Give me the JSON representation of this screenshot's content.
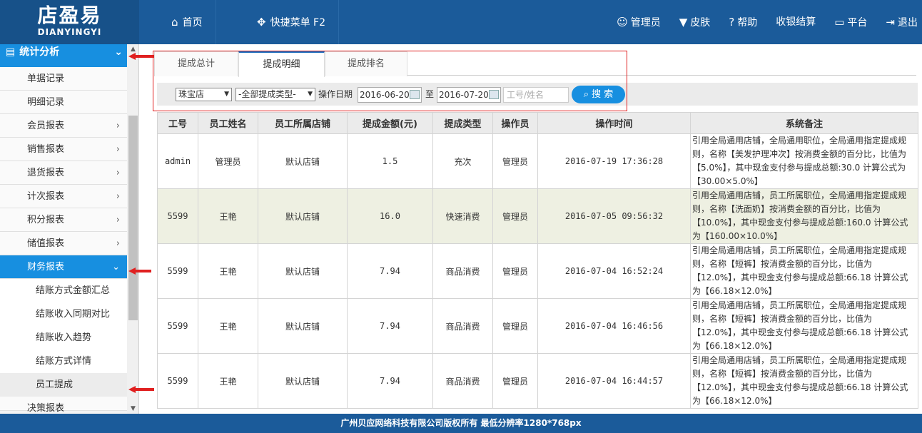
{
  "app": {
    "logo_cn": "店盈易",
    "logo_en": "DIANYINGYI"
  },
  "topnav": [
    {
      "icon": "home-icon",
      "glyph": "⌂",
      "label": "首页"
    },
    {
      "icon": "move-icon",
      "glyph": "✥",
      "label": "快捷菜单 F2"
    }
  ],
  "topright": [
    {
      "icon": "user-icon",
      "glyph": "👤",
      "label": "管理员"
    },
    {
      "icon": "shirt-icon",
      "glyph": "👕",
      "label": "皮肤"
    },
    {
      "icon": "help-icon",
      "glyph": "?",
      "label": "帮助"
    },
    {
      "icon": "",
      "glyph": "",
      "label": "收银结算"
    },
    {
      "icon": "monitor-icon",
      "glyph": "▭",
      "label": "平台"
    },
    {
      "icon": "logout-icon",
      "glyph": "⇥",
      "label": "退出"
    }
  ],
  "sidebar": {
    "header": "统计分析",
    "items": [
      "单据记录",
      "明细记录",
      "会员报表",
      "销售报表",
      "退货报表",
      "计次报表",
      "积分报表",
      "储值报表"
    ],
    "active": "财务报表",
    "subitems": [
      "结账方式金额汇总",
      "结账收入同期对比",
      "结账收入趋势",
      "结账方式详情",
      "员工提成"
    ],
    "next": "决策报表"
  },
  "tabs": [
    "提成总计",
    "提成明细",
    "提成排名"
  ],
  "filter": {
    "store": "珠宝店",
    "type": "-全部提成类型-",
    "date_label": "操作日期",
    "date_from": "2016-06-20",
    "to_label": "至",
    "date_to": "2016-07-20",
    "placeholder": "工号/姓名",
    "search": "搜 索"
  },
  "table": {
    "headers": [
      "工号",
      "员工姓名",
      "员工所属店铺",
      "提成金额(元)",
      "提成类型",
      "操作员",
      "操作时间",
      "系统备注"
    ],
    "rows": [
      {
        "id": "admin",
        "name": "管理员",
        "store": "默认店铺",
        "amount": "1.5",
        "type": "充次",
        "operator": "管理员",
        "time": "2016-07-19 17:36:28",
        "note": "引用全局通用店铺，全局通用职位，全局通用指定提成规则，名称【美发护理冲次】按消费金额的百分比，比值为【5.0%】，其中现金支付参与提成总额:30.0 计算公式为【30.00×5.0%】"
      },
      {
        "id": "5599",
        "name": "王艳",
        "store": "默认店铺",
        "amount": "16.0",
        "type": "快速消费",
        "operator": "管理员",
        "time": "2016-07-05 09:56:32",
        "note": "引用全局通用店铺，员工所属职位，全局通用指定提成规则，名称【洗面奶】按消费金额的百分比，比值为【10.0%】，其中现金支付参与提成总额:160.0 计算公式为【160.00×10.0%】"
      },
      {
        "id": "5599",
        "name": "王艳",
        "store": "默认店铺",
        "amount": "7.94",
        "type": "商品消费",
        "operator": "管理员",
        "time": "2016-07-04 16:52:24",
        "note": "引用全局通用店铺，员工所属职位，全局通用指定提成规则，名称【短裤】按消费金额的百分比，比值为【12.0%】，其中现金支付参与提成总额:66.18 计算公式为【66.18×12.0%】"
      },
      {
        "id": "5599",
        "name": "王艳",
        "store": "默认店铺",
        "amount": "7.94",
        "type": "商品消费",
        "operator": "管理员",
        "time": "2016-07-04 16:46:56",
        "note": "引用全局通用店铺，员工所属职位，全局通用指定提成规则，名称【短裤】按消费金额的百分比，比值为【12.0%】，其中现金支付参与提成总额:66.18 计算公式为【66.18×12.0%】"
      },
      {
        "id": "5599",
        "name": "王艳",
        "store": "默认店铺",
        "amount": "7.94",
        "type": "商品消费",
        "operator": "管理员",
        "time": "2016-07-04 16:44:57",
        "note": "引用全局通用店铺，员工所属职位，全局通用指定提成规则，名称【短裤】按消费金额的百分比，比值为【12.0%】，其中现金支付参与提成总额:66.18 计算公式为【66.18×12.0%】"
      }
    ]
  },
  "footer": "广州贝应网络科技有限公司版权所有 最低分辨率1280*768px"
}
